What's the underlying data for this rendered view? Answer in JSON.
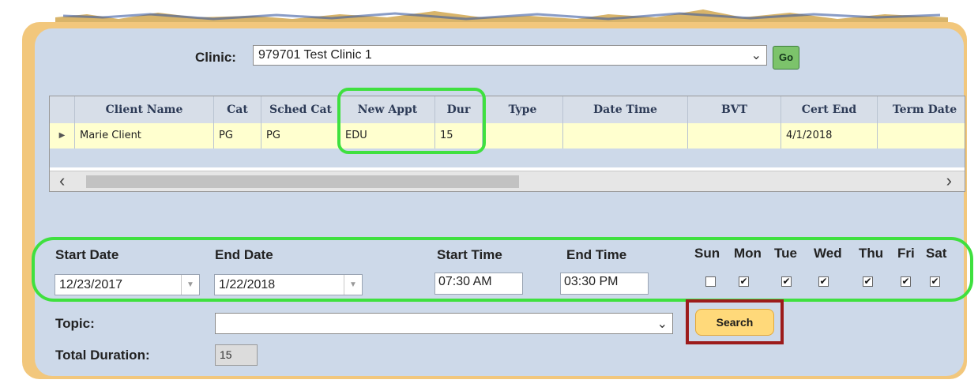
{
  "clinic": {
    "label": "Clinic:",
    "value": "979701 Test Clinic 1",
    "go_label": "Go"
  },
  "grid": {
    "columns": [
      "Client Name",
      "Cat",
      "Sched Cat",
      "New Appt",
      "Dur",
      "Type",
      "Date Time",
      "BVT",
      "Cert End",
      "Term Date"
    ],
    "row": {
      "client_name": "Marie Client",
      "cat": "PG",
      "sched_cat": "PG",
      "new_appt": "EDU",
      "dur": "15",
      "type": "",
      "date_time": "",
      "bvt": "",
      "cert_end": "4/1/2018",
      "term_date": ""
    }
  },
  "filters": {
    "start_date_label": "Start Date",
    "start_date": "12/23/2017",
    "end_date_label": "End Date",
    "end_date": "1/22/2018",
    "start_time_label": "Start Time",
    "start_time": "07:30 AM",
    "end_time_label": "End Time",
    "end_time": "03:30 PM",
    "days": [
      {
        "label": "Sun",
        "checked": false
      },
      {
        "label": "Mon",
        "checked": true
      },
      {
        "label": "Tue",
        "checked": true
      },
      {
        "label": "Wed",
        "checked": true
      },
      {
        "label": "Thu",
        "checked": true
      },
      {
        "label": "Fri",
        "checked": true
      },
      {
        "label": "Sat",
        "checked": true
      }
    ]
  },
  "topic": {
    "label": "Topic:",
    "value": ""
  },
  "search_label": "Search",
  "total_duration": {
    "label": "Total Duration:",
    "value": "15"
  },
  "colors": {
    "panel_bg": "#cdd9e9",
    "frame_gold": "#f2c77c",
    "highlight_green": "#3fe03f",
    "highlight_red": "#9c1b1b",
    "selected_row": "#ffffcf",
    "search_button": "#ffd97a",
    "go_button": "#7cc36b"
  }
}
